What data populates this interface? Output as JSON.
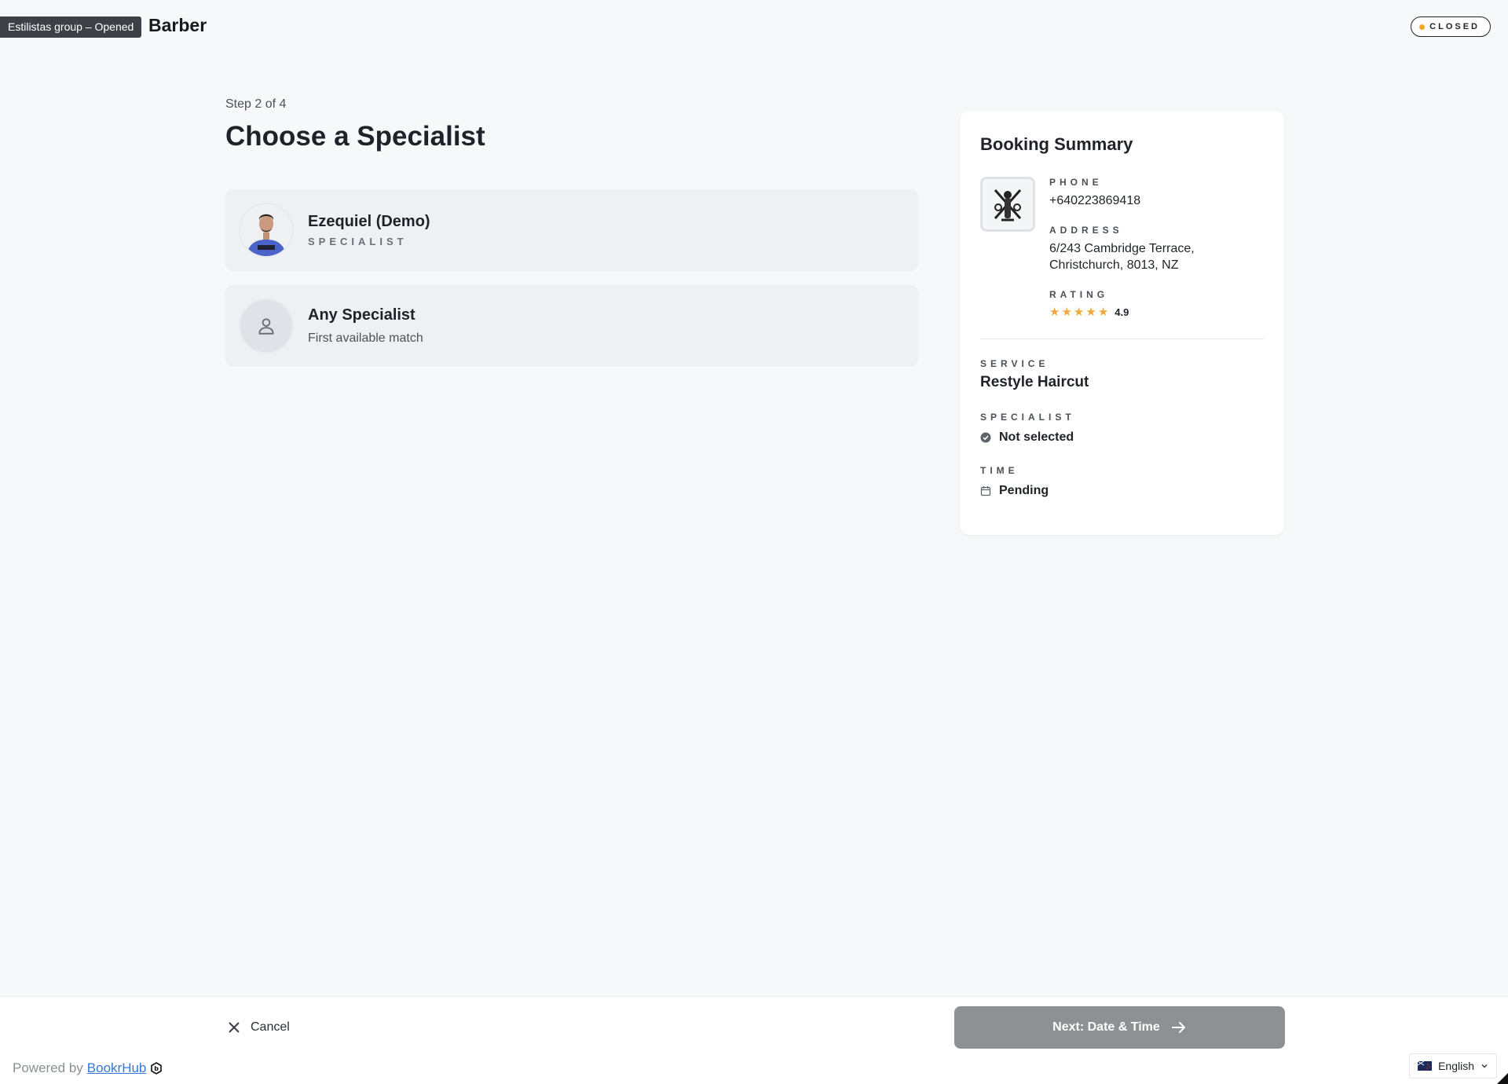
{
  "header": {
    "group_tag": "Estilistas group – Opened",
    "brand": "Barber",
    "status": "CLOSED"
  },
  "main": {
    "step": "Step 2 of 4",
    "title": "Choose a Specialist",
    "specialists": [
      {
        "name": "Ezequiel (Demo)",
        "sub": "SPECIALIST"
      },
      {
        "name": "Any Specialist",
        "sub": "First available match"
      }
    ]
  },
  "summary": {
    "title": "Booking Summary",
    "phone_label": "PHONE",
    "phone": "+640223869418",
    "address_label": "ADDRESS",
    "address_line1": "6/243 Cambridge Terrace,",
    "address_line2": "Christchurch, 8013, NZ",
    "rating_label": "RATING",
    "rating": "4.9",
    "stars": 5,
    "service_label": "SERVICE",
    "service": "Restyle Haircut",
    "specialist_label": "SPECIALIST",
    "specialist": "Not selected",
    "time_label": "TIME",
    "time": "Pending"
  },
  "footer": {
    "cancel": "Cancel",
    "next": "Next: Date & Time",
    "powered_prefix": "Powered by",
    "powered_link": "BookrHub",
    "language": "English"
  },
  "colors": {
    "background": "#f6f8fa",
    "star": "#f2a93b",
    "status_dot": "#f5a623",
    "next_button": "#8e9094",
    "link": "#3578d8"
  }
}
